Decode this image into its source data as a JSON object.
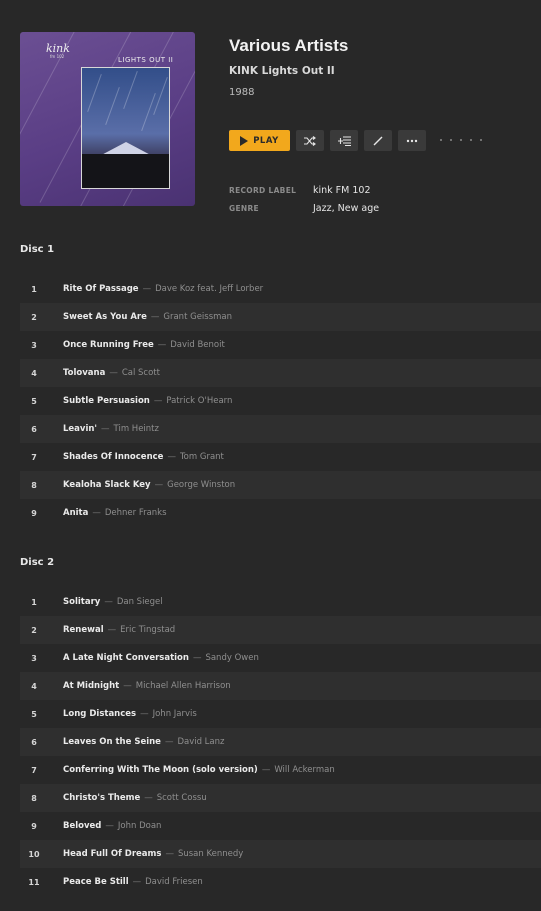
{
  "album": {
    "artist": "Various Artists",
    "title": "KINK Lights Out II",
    "year": "1988",
    "cover_text": {
      "logo": "kink",
      "logo_sub": "fm 102",
      "title": "LIGHTS OUT II"
    },
    "play_label": "PLAY",
    "info": [
      {
        "key": "RECORD LABEL",
        "value": "kink FM 102"
      },
      {
        "key": "GENRE",
        "value": "Jazz, New age"
      }
    ]
  },
  "toolbar_icons": [
    "shuffle-icon",
    "add-to-queue-icon",
    "edit-icon",
    "more-icon"
  ],
  "accent_color": "#f2a81c",
  "discs": [
    {
      "title": "Disc 1",
      "tracks": [
        {
          "no": "1",
          "title": "Rite Of Passage",
          "artist": "Dave Koz feat. Jeff Lorber"
        },
        {
          "no": "2",
          "title": "Sweet As You Are",
          "artist": "Grant Geissman"
        },
        {
          "no": "3",
          "title": "Once Running Free",
          "artist": "David Benoit"
        },
        {
          "no": "4",
          "title": "Tolovana",
          "artist": "Cal Scott"
        },
        {
          "no": "5",
          "title": "Subtle Persuasion",
          "artist": "Patrick O'Hearn"
        },
        {
          "no": "6",
          "title": "Leavin'",
          "artist": "Tim Heintz"
        },
        {
          "no": "7",
          "title": "Shades Of Innocence",
          "artist": "Tom Grant"
        },
        {
          "no": "8",
          "title": "Kealoha Slack Key",
          "artist": "George Winston"
        },
        {
          "no": "9",
          "title": "Anita",
          "artist": "Dehner Franks"
        }
      ]
    },
    {
      "title": "Disc 2",
      "tracks": [
        {
          "no": "1",
          "title": "Solitary",
          "artist": "Dan Siegel"
        },
        {
          "no": "2",
          "title": "Renewal",
          "artist": "Eric Tingstad"
        },
        {
          "no": "3",
          "title": "A Late Night Conversation",
          "artist": "Sandy Owen"
        },
        {
          "no": "4",
          "title": "At Midnight",
          "artist": "Michael Allen Harrison"
        },
        {
          "no": "5",
          "title": "Long Distances",
          "artist": "John Jarvis"
        },
        {
          "no": "6",
          "title": "Leaves On the Seine",
          "artist": "David Lanz"
        },
        {
          "no": "7",
          "title": "Conferring With The Moon (solo version)",
          "artist": "Will Ackerman"
        },
        {
          "no": "8",
          "title": "Christo's Theme",
          "artist": "Scott Cossu"
        },
        {
          "no": "9",
          "title": "Beloved",
          "artist": "John Doan"
        },
        {
          "no": "10",
          "title": "Head Full Of Dreams",
          "artist": "Susan Kennedy"
        },
        {
          "no": "11",
          "title": "Peace Be Still",
          "artist": "David Friesen"
        }
      ]
    }
  ]
}
